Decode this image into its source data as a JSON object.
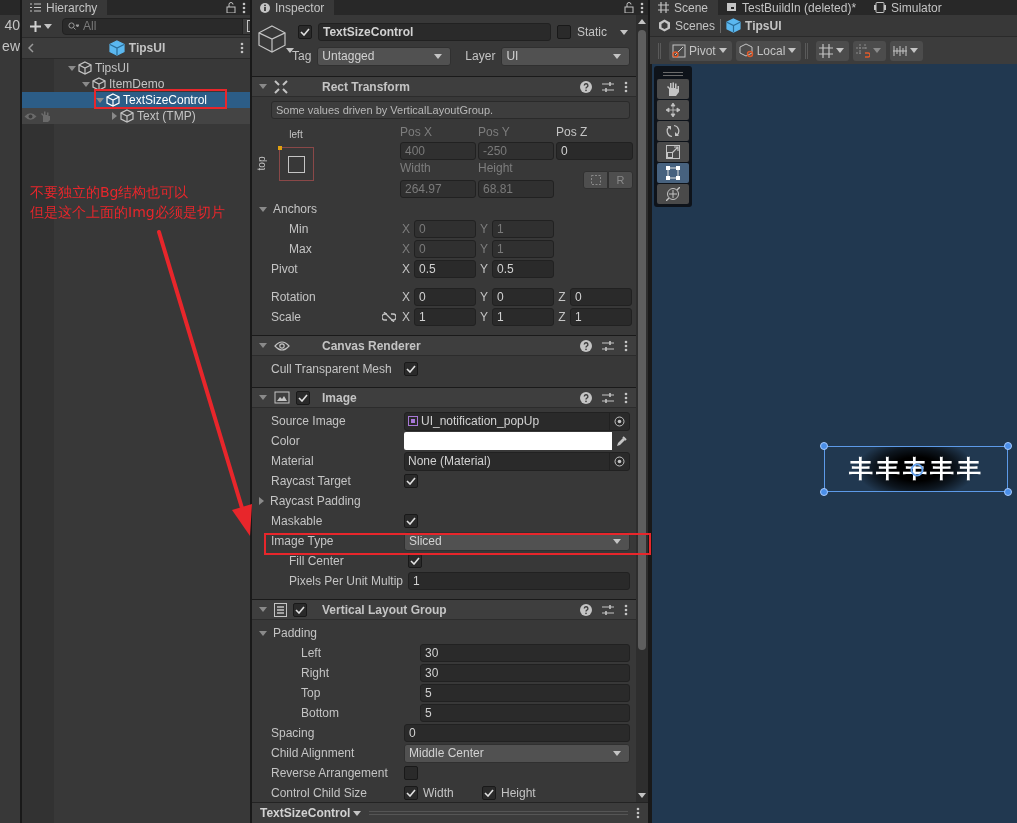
{
  "left_strip": {
    "texts": [
      "40",
      "ew"
    ]
  },
  "hierarchy": {
    "tab": "Hierarchy",
    "search": {
      "placeholder": "All"
    },
    "breadcrumb": "TipsUI",
    "tree": [
      {
        "label": "TipsUI",
        "expanded": true,
        "selected": false,
        "hovered": false,
        "children": [
          {
            "label": "ItemDemo",
            "expanded": true,
            "selected": false,
            "hovered": false,
            "children": [
              {
                "label": "TextSizeControl",
                "expanded": true,
                "selected": true,
                "hovered": false,
                "children": [
                  {
                    "label": "Text (TMP)",
                    "expanded": false,
                    "selected": false,
                    "hovered": true
                  }
                ]
              }
            ]
          }
        ]
      }
    ]
  },
  "inspector": {
    "tab": "Inspector",
    "object": {
      "active": true,
      "name": "TextSizeControl",
      "static": false,
      "static_label": "Static",
      "tag_label": "Tag",
      "tag": "Untagged",
      "layer_label": "Layer",
      "layer": "UI"
    },
    "components": [
      {
        "kind": "rect_transform",
        "title": "Rect Transform",
        "expanded": true,
        "note": "Some values driven by VerticalLayoutGroup.",
        "anchor_labels": {
          "horizontal": "left",
          "vertical": "top"
        },
        "position_fields": [
          {
            "label": "Pos X",
            "value": "400",
            "disabled": true
          },
          {
            "label": "Pos Y",
            "value": "-250",
            "disabled": true
          },
          {
            "label": "Pos Z",
            "value": "0",
            "disabled": false
          },
          {
            "label": "Width",
            "value": "264.97",
            "disabled": true
          },
          {
            "label": "Height",
            "value": "68.81",
            "disabled": true
          }
        ],
        "raw_button": "R",
        "anchors": {
          "label": "Anchors",
          "expanded": true,
          "rows": [
            {
              "kind": "vector",
              "label": "Min",
              "disabled": true,
              "fields": [
                {
                  "axis": "X",
                  "value": "0"
                },
                {
                  "axis": "Y",
                  "value": "1"
                }
              ]
            },
            {
              "kind": "vector",
              "label": "Max",
              "disabled": true,
              "fields": [
                {
                  "axis": "X",
                  "value": "0"
                },
                {
                  "axis": "Y",
                  "value": "1"
                }
              ]
            }
          ]
        },
        "rows": [
          {
            "kind": "vector",
            "label": "Pivot",
            "disabled": false,
            "fields": [
              {
                "axis": "X",
                "value": "0.5"
              },
              {
                "axis": "Y",
                "value": "0.5"
              }
            ]
          },
          {
            "kind": "vector",
            "label": "Rotation",
            "disabled": false,
            "fields": [
              {
                "axis": "X",
                "value": "0"
              },
              {
                "axis": "Y",
                "value": "0"
              },
              {
                "axis": "Z",
                "value": "0"
              }
            ]
          },
          {
            "kind": "vector",
            "label": "Scale",
            "disabled": false,
            "constrained": false,
            "fields": [
              {
                "axis": "X",
                "value": "1"
              },
              {
                "axis": "Y",
                "value": "1"
              },
              {
                "axis": "Z",
                "value": "1"
              }
            ]
          }
        ]
      },
      {
        "kind": "canvas_renderer",
        "title": "Canvas Renderer",
        "expanded": true,
        "rows": [
          {
            "kind": "checkbox",
            "label": "Cull Transparent Mesh",
            "checked": true
          }
        ]
      },
      {
        "kind": "image",
        "title": "Image",
        "enabled": true,
        "expanded": true,
        "rows": [
          {
            "kind": "object",
            "label": "Source Image",
            "value": "UI_notification_popUp",
            "icon": true
          },
          {
            "kind": "color",
            "label": "Color",
            "color": "#ffffff"
          },
          {
            "kind": "object",
            "label": "Material",
            "value": "None (Material)"
          },
          {
            "kind": "checkbox",
            "label": "Raycast Target",
            "checked": true
          },
          {
            "kind": "foldout",
            "label": "Raycast Padding",
            "expanded": false
          },
          {
            "kind": "checkbox",
            "label": "Maskable",
            "checked": true
          },
          {
            "kind": "dropdown",
            "label": "Image Type",
            "value": "Sliced",
            "children": [
              {
                "kind": "checkbox",
                "label": "Fill Center",
                "checked": true
              },
              {
                "kind": "number",
                "label": "Pixels Per Unit Multip",
                "value": "1"
              }
            ]
          }
        ]
      },
      {
        "kind": "vertical_layout_group",
        "title": "Vertical Layout Group",
        "enabled": true,
        "expanded": true,
        "rows": [
          {
            "kind": "foldout",
            "label": "Padding",
            "expanded": true,
            "children": [
              {
                "kind": "number",
                "label": "Left",
                "value": "30"
              },
              {
                "kind": "number",
                "label": "Right",
                "value": "30"
              },
              {
                "kind": "number",
                "label": "Top",
                "value": "5"
              },
              {
                "kind": "number",
                "label": "Bottom",
                "value": "5"
              }
            ]
          },
          {
            "kind": "number",
            "label": "Spacing",
            "value": "0"
          },
          {
            "kind": "dropdown",
            "label": "Child Alignment",
            "value": "Middle Center"
          },
          {
            "kind": "checkbox",
            "label": "Reverse Arrangement",
            "checked": false
          },
          {
            "kind": "checkbox_pair",
            "label": "Control Child Size",
            "options": [
              {
                "label": "Width",
                "checked": true
              },
              {
                "label": "Height",
                "checked": true
              }
            ]
          }
        ]
      }
    ],
    "footer": {
      "title": "TextSizeControl"
    }
  },
  "scene": {
    "tabs": [
      {
        "label": "Scene",
        "kind": "scene",
        "selected": true
      },
      {
        "label": "TestBuildIn (deleted)*",
        "kind": "game",
        "selected": false
      },
      {
        "label": "Simulator",
        "kind": "simulator",
        "selected": false
      }
    ],
    "breadcrumbs": [
      "Scenes",
      "TipsUI"
    ],
    "toolbar": {
      "pivot": "Pivot",
      "space": "Local"
    },
    "tools": [
      {
        "kind": "hand",
        "selected": false
      },
      {
        "kind": "move",
        "selected": false
      },
      {
        "kind": "rotate",
        "selected": false
      },
      {
        "kind": "scale",
        "selected": false
      },
      {
        "kind": "rect",
        "selected": true
      },
      {
        "kind": "transform",
        "selected": false
      }
    ],
    "object_text": "丰丰丰丰丰"
  },
  "annotation": {
    "lines": [
      "不要独立的Bg结构也可以",
      "但是这个上面的Img必须是切片"
    ]
  }
}
